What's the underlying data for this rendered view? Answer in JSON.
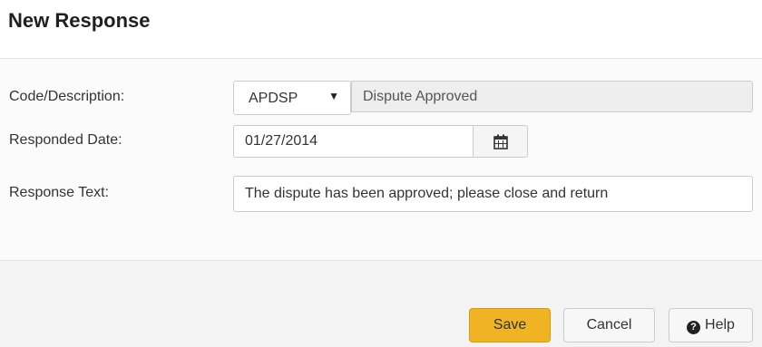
{
  "dialog": {
    "title": "New Response"
  },
  "form": {
    "code_label": "Code/Description:",
    "code_value": "APDSP",
    "description_value": "Dispute Approved",
    "responded_date_label": "Responded Date:",
    "responded_date_value": "01/27/2014",
    "response_text_label": "Response Text:",
    "response_text_value": "The dispute has been approved; please close and return"
  },
  "buttons": {
    "save": "Save",
    "cancel": "Cancel",
    "help": "Help"
  },
  "colors": {
    "save_button": "#f0b323",
    "readonly_field": "#eeeeee"
  }
}
